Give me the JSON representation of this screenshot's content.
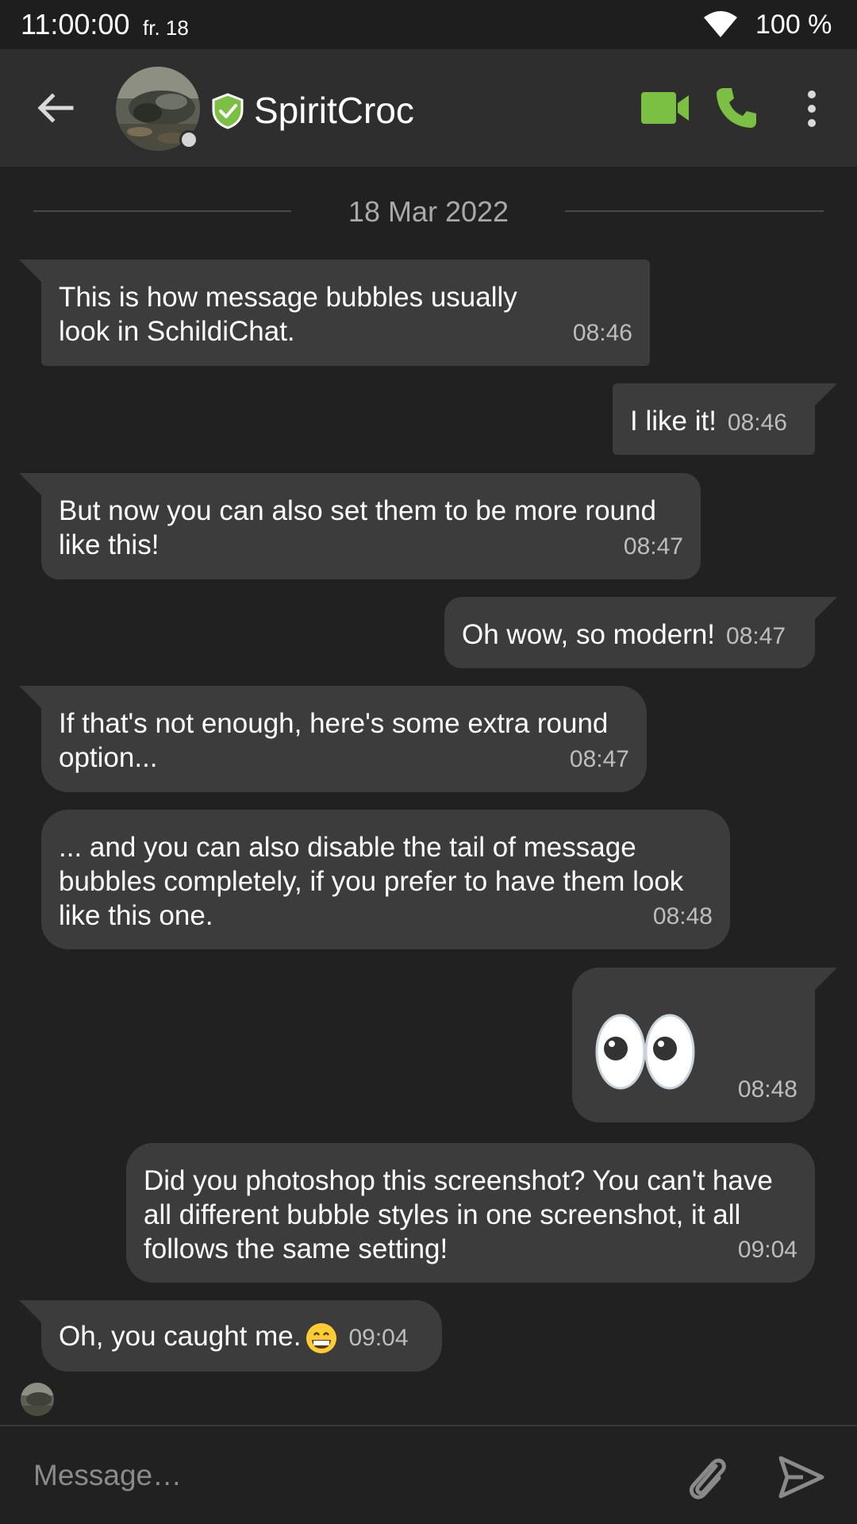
{
  "status_bar": {
    "time": "11:00:00",
    "date": "fr. 18",
    "battery": "100 %",
    "wifi_icon": "wifi-icon"
  },
  "toolbar": {
    "back_icon": "arrow-left-icon",
    "room_name": "SpiritCroc",
    "verified_icon": "shield-check-icon",
    "video_call_icon": "video-camera-icon",
    "voice_call_icon": "phone-icon",
    "more_icon": "more-vertical-icon",
    "accent_color": "#7bc043"
  },
  "timeline": {
    "date_separator": "18 Mar 2022",
    "messages": [
      {
        "side": "received",
        "text": "This is how message bubbles usually look in SchildiChat.",
        "time": "08:46"
      },
      {
        "side": "sent",
        "text": "I like it!",
        "time": "08:46"
      },
      {
        "side": "received",
        "text": "But now you can also set them to be more round like this!",
        "time": "08:47"
      },
      {
        "side": "sent",
        "text": "Oh wow, so modern!",
        "time": "08:47"
      },
      {
        "side": "received",
        "text": "If that's not enough, here's some extra round option...",
        "time": "08:47"
      },
      {
        "side": "received",
        "text": "... and you can also disable the tail of message bubbles completely, if you prefer to have them look like this one.",
        "time": "08:48"
      },
      {
        "side": "sent",
        "text": "",
        "emoji": "eyes-emoji",
        "time": "08:48"
      },
      {
        "side": "sent",
        "text": "Did you photoshop this screenshot? You can't have all different bubble styles in one screenshot, it all follows the same setting!",
        "time": "09:04"
      },
      {
        "side": "received",
        "text": "Oh, you caught me.",
        "emoji": "grinning-emoji",
        "time": "09:04"
      }
    ]
  },
  "composer": {
    "placeholder": "Message…",
    "attach_icon": "paperclip-icon",
    "send_icon": "send-icon"
  },
  "colors": {
    "background": "#212121",
    "toolbar": "#2e2e2e",
    "bubble": "#3c3c3c",
    "accent": "#7bc043"
  }
}
